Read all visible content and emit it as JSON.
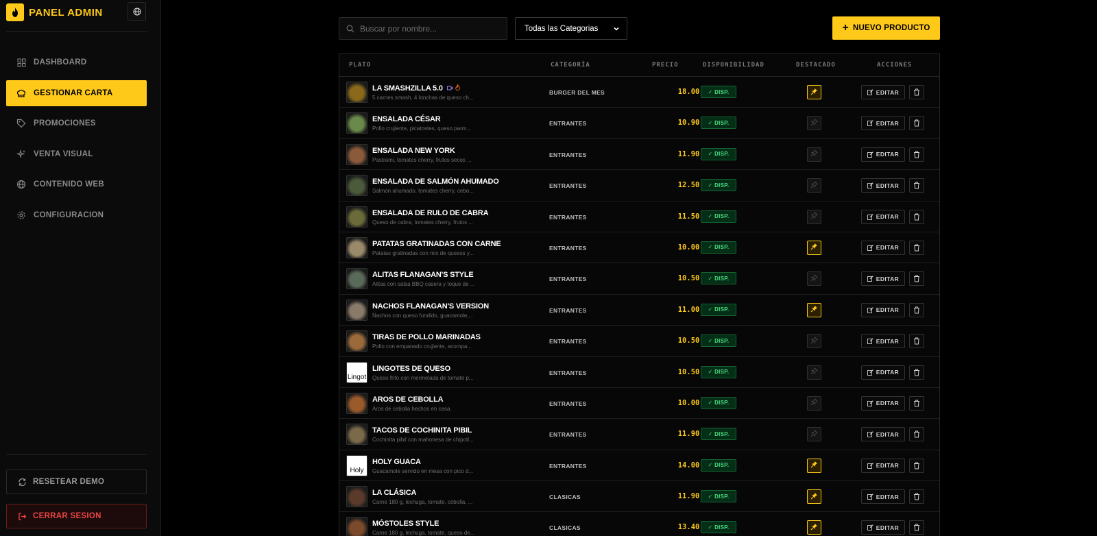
{
  "sidebar": {
    "brand_title": "PANEL ADMIN",
    "nav": [
      {
        "label": "DASHBOARD",
        "icon": "grid-icon",
        "active": false
      },
      {
        "label": "GESTIONAR CARTA",
        "icon": "chef-hat-icon",
        "active": true
      },
      {
        "label": "PROMOCIONES",
        "icon": "tag-icon",
        "active": false
      },
      {
        "label": "VENTA VISUAL",
        "icon": "sparkles-icon",
        "active": false
      },
      {
        "label": "CONTENIDO WEB",
        "icon": "globe-icon",
        "active": false
      },
      {
        "label": "CONFIGURACION",
        "icon": "gear-icon",
        "active": false
      }
    ],
    "reset_label": "RESETEAR DEMO",
    "logout_label": "CERRAR SESION"
  },
  "toolbar": {
    "search_placeholder": "Buscar por nombre...",
    "category_selected": "Todas las Categorias",
    "new_label": "NUEVO PRODUCTO"
  },
  "table": {
    "headers": {
      "plato": "PLATO",
      "categoria": "CATEGORÍA",
      "precio": "PRECIO",
      "disponibilidad": "DISPONIBILIDAD",
      "destacado": "DESTACADO",
      "acciones": "ACCIONES"
    },
    "avail_label": "✓ DISP.",
    "edit_label": "EDITAR",
    "rows": [
      {
        "name": "LA SMASHZILLA 5.0",
        "desc": "5 carnes smash, 4 lonchas de queso ch...",
        "category": "BURGER DEL MES",
        "price": "18.00 €",
        "featured": true,
        "thumb": "#8a6a1a",
        "broken_alt": ""
      },
      {
        "name": "ENSALADA CÉSAR",
        "desc": "Pollo crujiente, picatostes, queso parm...",
        "category": "ENTRANTES",
        "price": "10.90 €",
        "featured": false,
        "thumb": "#6a8a4a",
        "broken_alt": ""
      },
      {
        "name": "ENSALADA NEW YORK",
        "desc": "Pastrami, tomates cherry, frutos secos ...",
        "category": "ENTRANTES",
        "price": "11.90 €",
        "featured": false,
        "thumb": "#8a5a3a",
        "broken_alt": ""
      },
      {
        "name": "ENSALADA DE SALMÓN AHUMADO",
        "desc": "Salmón ahumado, tomates cherry, cebo...",
        "category": "ENTRANTES",
        "price": "12.50 €",
        "featured": false,
        "thumb": "#4a5a3a",
        "broken_alt": ""
      },
      {
        "name": "ENSALADA DE RULO DE CABRA",
        "desc": "Queso de cabra, tomates cherry, frutos ...",
        "category": "ENTRANTES",
        "price": "11.50 €",
        "featured": false,
        "thumb": "#6a6a3a",
        "broken_alt": ""
      },
      {
        "name": "PATATAS GRATINADAS CON CARNE",
        "desc": "Patatas gratinadas con mix de quesos y...",
        "category": "ENTRANTES",
        "price": "10.00 €",
        "featured": true,
        "thumb": "#9a8a6a",
        "broken_alt": ""
      },
      {
        "name": "ALITAS FLANAGAN'S STYLE",
        "desc": "Alitas con salsa BBQ casera y toque de ...",
        "category": "ENTRANTES",
        "price": "10.50 €",
        "featured": false,
        "thumb": "#5a6a5a",
        "broken_alt": ""
      },
      {
        "name": "NACHOS FLANAGAN'S VERSION",
        "desc": "Nachos con queso fundido, guacamole,...",
        "category": "ENTRANTES",
        "price": "11.00 €",
        "featured": true,
        "thumb": "#8a7a6a",
        "broken_alt": ""
      },
      {
        "name": "TIRAS DE POLLO MARINADAS",
        "desc": "Pollo con empanado crujiente, acompa...",
        "category": "ENTRANTES",
        "price": "10.50 €",
        "featured": false,
        "thumb": "#9a6a3a",
        "broken_alt": ""
      },
      {
        "name": "LINGOTES DE QUESO",
        "desc": "Queso frito con mermelada de tomate p...",
        "category": "ENTRANTES",
        "price": "10.50 €",
        "featured": false,
        "thumb": "",
        "broken_alt": "Lingot"
      },
      {
        "name": "AROS DE CEBOLLA",
        "desc": "Aros de cebolla hechos en casa.",
        "category": "ENTRANTES",
        "price": "10.00 €",
        "featured": false,
        "thumb": "#9a5a2a",
        "broken_alt": ""
      },
      {
        "name": "TACOS DE COCHINITA PIBIL",
        "desc": "Cochinita pibil con mahonesa de chipotl...",
        "category": "ENTRANTES",
        "price": "11.90 €",
        "featured": false,
        "thumb": "#7a6a4a",
        "broken_alt": ""
      },
      {
        "name": "HOLY GUACA",
        "desc": "Guacamole servido en mesa con pico d...",
        "category": "ENTRANTES",
        "price": "14.00 €",
        "featured": true,
        "thumb": "",
        "broken_alt": "Holy"
      },
      {
        "name": "LA CLÁSICA",
        "desc": "Carne 180 g, lechuga, tomate, cebolla, ...",
        "category": "CLASICAS",
        "price": "11.90 €",
        "featured": true,
        "thumb": "#5a3a2a",
        "broken_alt": ""
      },
      {
        "name": "MÓSTOLES STYLE",
        "desc": "Carne 180 g, lechuga, tomate, queso de...",
        "category": "CLASICAS",
        "price": "13.40 €",
        "featured": true,
        "thumb": "#7a4a2a",
        "broken_alt": ""
      }
    ]
  },
  "colors": {
    "accent": "#ffc91a",
    "available": "#4ade80",
    "danger": "#ef4444"
  }
}
